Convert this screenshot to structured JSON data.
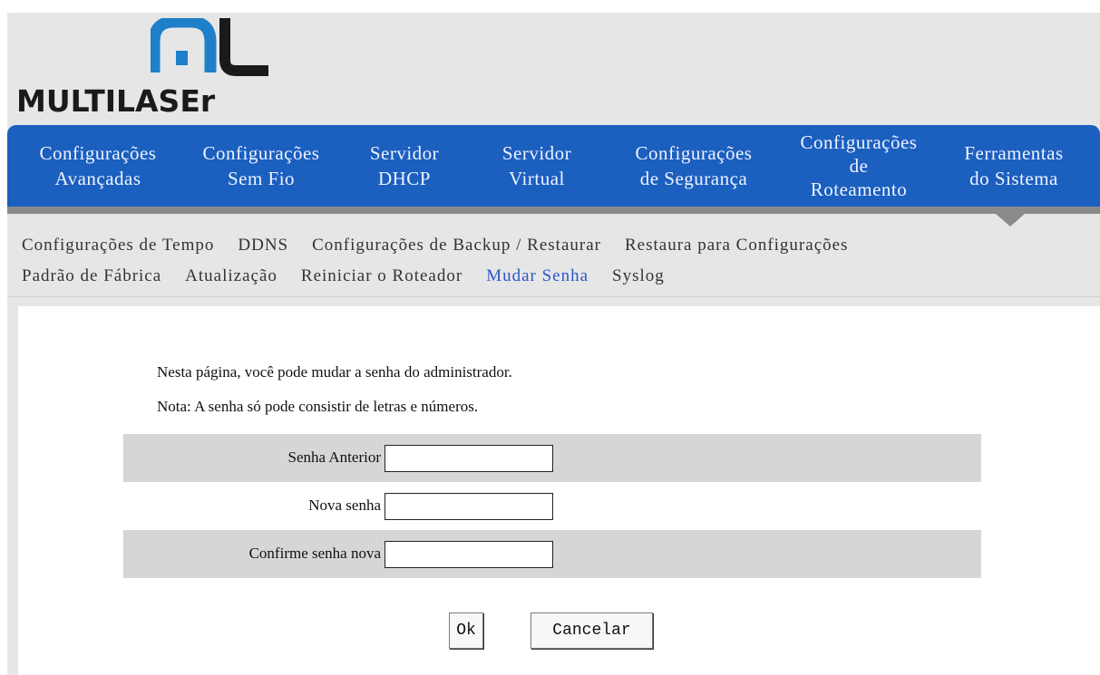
{
  "brand": {
    "name": "MULTILASEr",
    "accent": "#1b5fbf"
  },
  "main_nav": {
    "items": [
      {
        "lines": [
          "Configurações",
          "Avançadas"
        ]
      },
      {
        "lines": [
          "Configurações",
          "Sem Fio"
        ]
      },
      {
        "lines": [
          "Servidor",
          "DHCP"
        ]
      },
      {
        "lines": [
          "Servidor",
          "Virtual"
        ]
      },
      {
        "lines": [
          "Configurações",
          "de Segurança"
        ]
      },
      {
        "lines": [
          "Configurações",
          "de",
          "Roteamento"
        ]
      },
      {
        "lines": [
          "Ferramentas",
          "do Sistema"
        ]
      }
    ]
  },
  "sub_nav": {
    "line1": [
      "Configurações de Tempo",
      "DDNS",
      "Configurações de Backup / Restaurar",
      "Restaura para Configurações"
    ],
    "line2": [
      "Padrão de Fábrica",
      "Atualização",
      "Reiniciar o Roteador",
      "Mudar Senha",
      "Syslog"
    ],
    "current": "Mudar Senha"
  },
  "content": {
    "intro": "Nesta página, você pode mudar a senha do administrador.",
    "note": "Nota: A senha só pode consistir de letras e números.",
    "fields": {
      "old_password": {
        "label": "Senha Anterior",
        "value": ""
      },
      "new_password": {
        "label": "Nova senha",
        "value": ""
      },
      "confirm_password": {
        "label": "Confirme senha nova",
        "value": ""
      }
    },
    "ok_label": "Ok",
    "cancel_label": "Cancelar"
  }
}
